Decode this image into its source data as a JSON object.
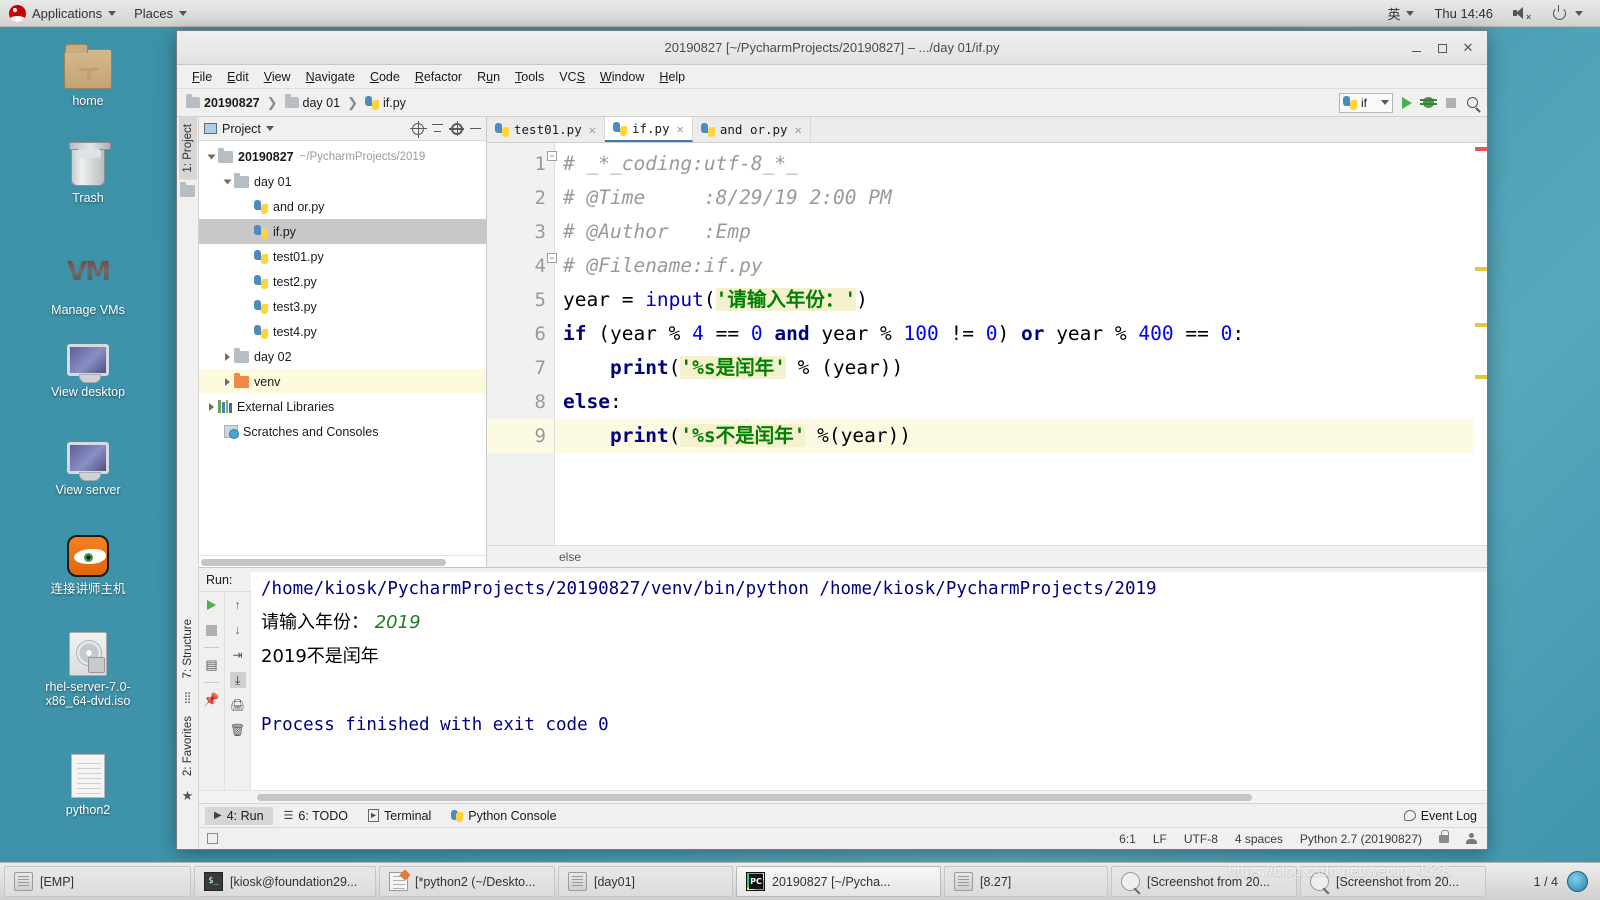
{
  "desktop": {
    "top_panel": {
      "applications": "Applications",
      "places": "Places",
      "input_method": "英",
      "clock": "Thu 14:46"
    },
    "icons": [
      {
        "label": "home",
        "icon": "home-folder-icon"
      },
      {
        "label": "Trash",
        "icon": "trash-icon"
      },
      {
        "label": "Manage VMs",
        "icon": "vmware-icon"
      },
      {
        "label": "View desktop",
        "icon": "monitor-icon"
      },
      {
        "label": "View server",
        "icon": "monitor-icon"
      },
      {
        "label": "连接讲师主机",
        "icon": "tiger-vnc-icon"
      },
      {
        "label": "rhel-server-7.0-x86_64-dvd.iso",
        "icon": "iso-disc-icon"
      },
      {
        "label": "python2",
        "icon": "text-document-icon"
      }
    ],
    "taskbar": {
      "items": [
        {
          "label": "[EMP]",
          "icon": "window-icon"
        },
        {
          "label": "[kiosk@foundation29...",
          "icon": "terminal-icon"
        },
        {
          "label": "[*python2 (~/Deskto...",
          "icon": "gedit-icon"
        },
        {
          "label": "[day01]",
          "icon": "window-icon"
        },
        {
          "label": "20190827 [~/Pycha...",
          "icon": "pycharm-icon"
        },
        {
          "label": "[8.27]",
          "icon": "window-icon"
        },
        {
          "label": "[Screenshot from 20...",
          "icon": "screenshot-icon"
        },
        {
          "label": "[Screenshot from 20...",
          "icon": "screenshot-icon"
        }
      ],
      "workspace": "1 / 4"
    },
    "watermark": "https://blog.csdn.net/weixin_4528"
  },
  "pycharm": {
    "window_title": "20190827 [~/PycharmProjects/20190827] – .../day 01/if.py",
    "menu": [
      "File",
      "Edit",
      "View",
      "Navigate",
      "Code",
      "Refactor",
      "Run",
      "Tools",
      "VCS",
      "Window",
      "Help"
    ],
    "navbar": {
      "crumbs": [
        "20190827",
        "day 01",
        "if.py"
      ],
      "run_config": "if"
    },
    "project_panel": {
      "title": "Project",
      "tree": [
        {
          "label": "20190827",
          "path": "~/PycharmProjects/2019",
          "type": "root",
          "indent": 0
        },
        {
          "label": "day 01",
          "path": "",
          "type": "folder",
          "indent": 1
        },
        {
          "label": "and or.py",
          "path": "",
          "type": "py",
          "indent": 2
        },
        {
          "label": "if.py",
          "path": "",
          "type": "py",
          "indent": 2
        },
        {
          "label": "test01.py",
          "path": "",
          "type": "py",
          "indent": 2
        },
        {
          "label": "test2.py",
          "path": "",
          "type": "py",
          "indent": 2
        },
        {
          "label": "test3.py",
          "path": "",
          "type": "py",
          "indent": 2
        },
        {
          "label": "test4.py",
          "path": "",
          "type": "py",
          "indent": 2
        },
        {
          "label": "day 02",
          "path": "",
          "type": "folder",
          "indent": 1
        },
        {
          "label": "venv",
          "path": "",
          "type": "venv",
          "indent": 1
        },
        {
          "label": "External Libraries",
          "path": "",
          "type": "lib",
          "indent": 0
        },
        {
          "label": "Scratches and Consoles",
          "path": "",
          "type": "scratch",
          "indent": 0
        }
      ]
    },
    "side_tabs": {
      "project": "1: Project",
      "structure": "7: Structure",
      "favorites": "2: Favorites"
    },
    "editor": {
      "tabs": [
        {
          "label": "test01.py",
          "active": false
        },
        {
          "label": "if.py",
          "active": true
        },
        {
          "label": "and or.py",
          "active": false
        }
      ],
      "lines": [
        {
          "n": "1",
          "tokens": [
            {
              "t": "# _*_coding:utf-8_*_",
              "c": "cmt"
            }
          ]
        },
        {
          "n": "2",
          "tokens": [
            {
              "t": "# @Time     :8/29/19 2:00 PM",
              "c": "cmt"
            }
          ]
        },
        {
          "n": "3",
          "tokens": [
            {
              "t": "# @Author   :Emp",
              "c": "cmt"
            }
          ]
        },
        {
          "n": "4",
          "tokens": [
            {
              "t": "# @Filename:if.py",
              "c": "cmt"
            }
          ]
        },
        {
          "n": "5",
          "tokens": [
            {
              "t": "year = ",
              "c": "plain"
            },
            {
              "t": "input",
              "c": "fn"
            },
            {
              "t": "(",
              "c": "plain"
            },
            {
              "t": "'请输入年份：'",
              "c": "str"
            },
            {
              "t": ")",
              "c": "plain"
            }
          ]
        },
        {
          "n": "6",
          "tokens": [
            {
              "t": "if",
              "c": "kw"
            },
            {
              "t": " (year % ",
              "c": "plain"
            },
            {
              "t": "4",
              "c": "num"
            },
            {
              "t": " == ",
              "c": "plain"
            },
            {
              "t": "0",
              "c": "num"
            },
            {
              "t": " ",
              "c": "plain"
            },
            {
              "t": "and",
              "c": "kw"
            },
            {
              "t": " year % ",
              "c": "plain"
            },
            {
              "t": "100",
              "c": "num"
            },
            {
              "t": " != ",
              "c": "plain"
            },
            {
              "t": "0",
              "c": "num"
            },
            {
              "t": ") ",
              "c": "plain"
            },
            {
              "t": "or",
              "c": "kw"
            },
            {
              "t": " year % ",
              "c": "plain"
            },
            {
              "t": "400",
              "c": "num"
            },
            {
              "t": " == ",
              "c": "plain"
            },
            {
              "t": "0",
              "c": "num"
            },
            {
              "t": ":",
              "c": "plain"
            }
          ]
        },
        {
          "n": "7",
          "tokens": [
            {
              "t": "    ",
              "c": "plain"
            },
            {
              "t": "print",
              "c": "kw"
            },
            {
              "t": "(",
              "c": "plain"
            },
            {
              "t": "'%s是闰年'",
              "c": "str"
            },
            {
              "t": " % (year))",
              "c": "plain"
            }
          ]
        },
        {
          "n": "8",
          "tokens": [
            {
              "t": "else",
              "c": "kw"
            },
            {
              "t": ":",
              "c": "plain"
            }
          ]
        },
        {
          "n": "9",
          "cur": true,
          "tokens": [
            {
              "t": "    ",
              "c": "plain"
            },
            {
              "t": "print",
              "c": "kw"
            },
            {
              "t": "(",
              "c": "plain"
            },
            {
              "t": "'%s不是闰年'",
              "c": "str"
            },
            {
              "t": " %(year))",
              "c": "plain"
            }
          ]
        }
      ],
      "breadcrumb": "else"
    },
    "run_panel": {
      "label": "Run:",
      "config": "if",
      "output": [
        {
          "text": "/home/kiosk/PycharmProjects/20190827/venv/bin/python /home/kiosk/PycharmProjects/2019",
          "kind": "path"
        },
        {
          "text": "请输入年份：",
          "echo": "2019",
          "kind": "prompt"
        },
        {
          "text": "2019不是闰年",
          "kind": "cn"
        },
        {
          "text": "",
          "kind": "blank"
        },
        {
          "text": "Process finished with exit code 0",
          "kind": "path"
        }
      ]
    },
    "bottom_tabs": [
      {
        "label": "4: Run",
        "icon": "play-icon",
        "active": true
      },
      {
        "label": "6: TODO",
        "icon": "list-icon",
        "active": false
      },
      {
        "label": "Terminal",
        "icon": "terminal-icon",
        "active": false
      },
      {
        "label": "Python Console",
        "icon": "python-icon",
        "active": false
      }
    ],
    "event_log": "Event Log",
    "status_bar": {
      "caret": "6:1",
      "line_sep": "LF",
      "encoding": "UTF-8",
      "indent": "4 spaces",
      "interpreter": "Python 2.7 (20190827)"
    }
  },
  "colors": {
    "accent": "#3c7ab5",
    "desktop_bg": "#3e93aa",
    "selection": "#c8c8c8",
    "highlight_line": "#fcfae2",
    "string": "#008000",
    "keyword": "#000080"
  }
}
